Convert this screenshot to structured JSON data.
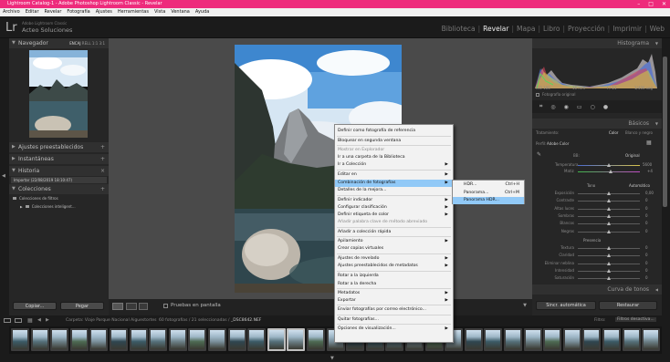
{
  "window": {
    "title": "Lightroom Catalog-1 - Adobe Photoshop Lightroom Classic - Revelar"
  },
  "menu": [
    "Archivo",
    "Editar",
    "Revelar",
    "Fotografía",
    "Ajustes",
    "Herramientas",
    "Vista",
    "Ventana",
    "Ayuda"
  ],
  "identity": {
    "logo": "Lr",
    "subtitle": "Adobe Lightroom Classic",
    "name": "Acteo Soluciones"
  },
  "modules": [
    "Biblioteca",
    "Revelar",
    "Mapa",
    "Libro",
    "Proyección",
    "Imprimir",
    "Web"
  ],
  "left": {
    "navigator": {
      "label": "Navegador",
      "zoom": [
        "ENCAJ",
        "RELL",
        "1:1",
        "3:1"
      ]
    },
    "panels": [
      "Ajustes preestablecidos",
      "Instantáneas",
      "Historia",
      "Colecciones"
    ],
    "history_item": "Importar (22/08/2019 18:10:47)",
    "collections": [
      "Colecciones de filtros",
      "Colecciones inteligent..."
    ],
    "copy": "Copiar...",
    "paste": "Pegar"
  },
  "toolbar": {
    "proof": "Pruebas en pantalla"
  },
  "filmstrip": {
    "path": "Carpeta: Viaje Parque Nacional Aiguestortes",
    "count": "60 fotografías / 21 seleccionadas /",
    "file": "_DSC8642.NEF",
    "filter_label": "Filtro:",
    "filter_value": "Filtros desactiva..."
  },
  "context_menu": [
    {
      "label": "Definir como fotografía de referencia"
    },
    {
      "label": "Bloquear en segunda ventana"
    },
    {
      "label": "Mostrar en Explorador",
      "disabled": true
    },
    {
      "label": "Ir a una carpeta de la Biblioteca"
    },
    {
      "label": "Ir a Colección",
      "submenu": true
    },
    {
      "label": "Editar en",
      "submenu": true
    },
    {
      "label": "Combinación de fotografías",
      "submenu": true,
      "highlight": true
    },
    {
      "label": "Detalles de la mejora..."
    },
    {
      "label": "Definir indicador",
      "submenu": true
    },
    {
      "label": "Configurar clasificación",
      "submenu": true
    },
    {
      "label": "Definir etiqueta de color",
      "submenu": true
    },
    {
      "label": "Añadir palabra clave de método abreviado",
      "disabled": true
    },
    {
      "label": "Añadir a colección rápida"
    },
    {
      "label": "Apilamiento",
      "submenu": true
    },
    {
      "label": "Crear copias virtuales"
    },
    {
      "label": "Ajustes de revelado",
      "submenu": true
    },
    {
      "label": "Ajustes preestablecidos de metadatos",
      "submenu": true
    },
    {
      "label": "Rotar a la izquierda"
    },
    {
      "label": "Rotar a la derecha"
    },
    {
      "label": "Metadatos",
      "submenu": true
    },
    {
      "label": "Exportar",
      "submenu": true
    },
    {
      "label": "Enviar fotografías por correo electrónico..."
    },
    {
      "label": "Quitar fotografías..."
    },
    {
      "label": "Opciones de visualización...",
      "submenu": true
    }
  ],
  "submenu": [
    {
      "label": "HDR...",
      "shortcut": "Ctrl+H"
    },
    {
      "label": "Panorama...",
      "shortcut": "Ctrl+M"
    },
    {
      "label": "Panorama HDR...",
      "shortcut": "",
      "highlight": true
    }
  ],
  "right": {
    "histogram": "Histograma",
    "hist_readouts": [
      "ISO 100",
      "16 mm",
      "f / 11",
      "1/400 seg"
    ],
    "original": "Fotografía original",
    "basicos": "Básicos",
    "tratamiento": "Tratamiento:",
    "color": "Color",
    "bn": "Blanco y negro",
    "perfil": "Perfil:",
    "perfil_val": "Adobe Color",
    "wb": "BB:",
    "wb_val": "Original",
    "temp": "Temperatura",
    "temp_val": "5600",
    "matiz": "Matiz",
    "matiz_val": "+4",
    "tono": "Tono",
    "auto": "Automático",
    "tone_rows": [
      {
        "label": "Exposición",
        "value": "0,00"
      },
      {
        "label": "Contraste",
        "value": "0"
      },
      {
        "label": "Altas luces",
        "value": "0"
      },
      {
        "label": "Sombras",
        "value": "0"
      },
      {
        "label": "Blancos",
        "value": "0"
      },
      {
        "label": "Negros",
        "value": "0"
      }
    ],
    "presencia": "Presencia",
    "pres_rows": [
      {
        "label": "Textura",
        "value": "0"
      },
      {
        "label": "Claridad",
        "value": "0"
      },
      {
        "label": "Eliminar neblina",
        "value": "0"
      },
      {
        "label": "Intensidad",
        "value": "0"
      },
      {
        "label": "Saturación",
        "value": "0"
      }
    ],
    "curva": "Curva de tonos",
    "sync": "Sincr. automática",
    "reset": "Restaurar"
  }
}
